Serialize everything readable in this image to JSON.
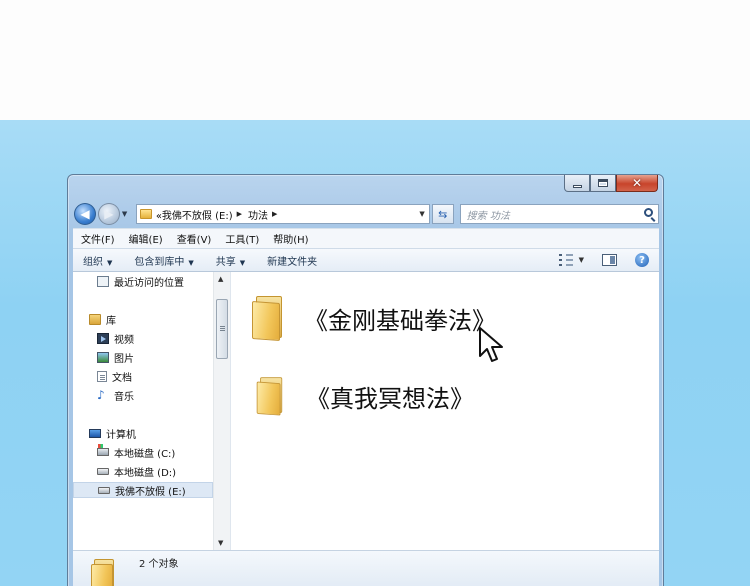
{
  "window": {
    "min_label": "—",
    "max_label": "□",
    "close_label": "✕"
  },
  "address": {
    "crumbs": [
      "«我佛不放假 (E:)",
      "功法"
    ],
    "search_placeholder": "搜索 功法"
  },
  "menu": [
    "文件(F)",
    "编辑(E)",
    "查看(V)",
    "工具(T)",
    "帮助(H)"
  ],
  "toolbar": {
    "organize": "组织",
    "include_library": "包含到库中",
    "share": "共享",
    "new_folder": "新建文件夹",
    "help": "?"
  },
  "nav": {
    "recent": "最近访问的位置",
    "library": "库",
    "videos": "视频",
    "pictures": "图片",
    "documents": "文档",
    "music": "音乐",
    "computer": "计算机",
    "drive_c": "本地磁盘 (C:)",
    "drive_d": "本地磁盘 (D:)",
    "drive_e": "我佛不放假 (E:)"
  },
  "files": [
    {
      "name": "《金刚基础拳法》"
    },
    {
      "name": "《真我冥想法》"
    }
  ],
  "status": {
    "count": "2 个对象"
  }
}
